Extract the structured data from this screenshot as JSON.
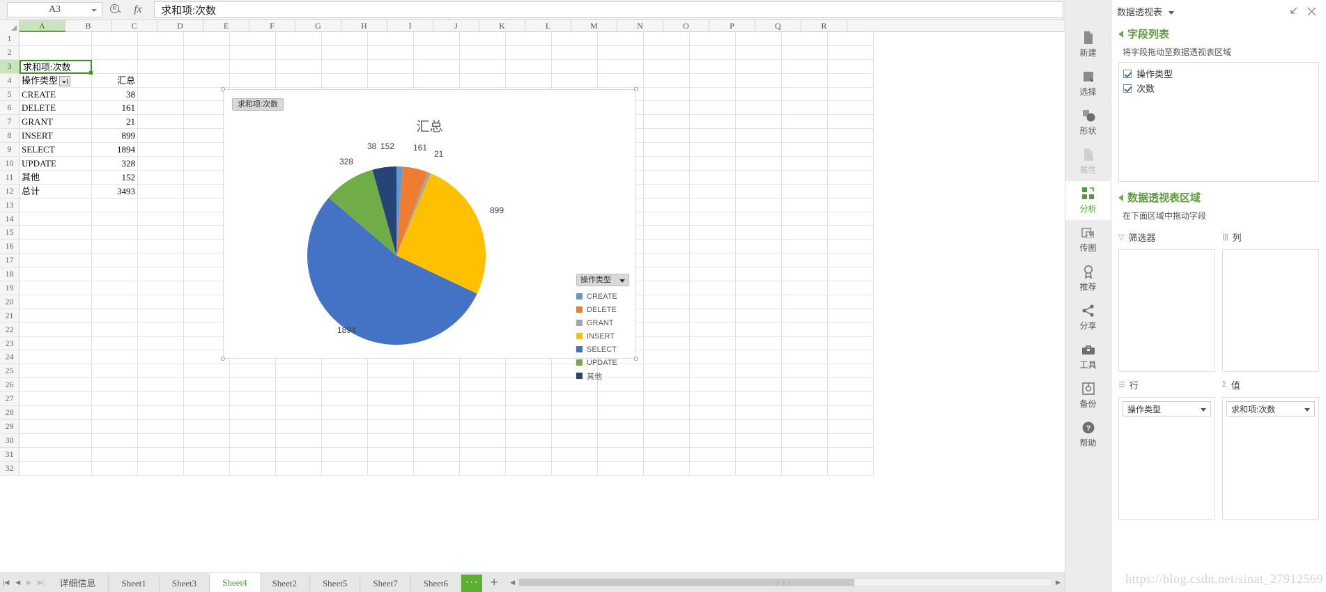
{
  "formula_bar": {
    "name_box_value": "A3",
    "search_icon": "search-icon",
    "fx_label": "fx",
    "formula_value": "求和项:次数"
  },
  "grid": {
    "columns": [
      "A",
      "B",
      "C",
      "D",
      "E",
      "F",
      "G",
      "H",
      "I",
      "J",
      "K",
      "L",
      "M",
      "N",
      "O",
      "P",
      "Q",
      "R"
    ],
    "selected_column": "A",
    "active_cell": "A3",
    "active_cell_value": "求和项:次数",
    "row_count": 32,
    "cells": {
      "A4": "操作类型",
      "B4": "汇总",
      "rows": [
        {
          "row": 5,
          "label": "CREATE",
          "value": "38"
        },
        {
          "row": 6,
          "label": "DELETE",
          "value": "161"
        },
        {
          "row": 7,
          "label": "GRANT",
          "value": "21"
        },
        {
          "row": 8,
          "label": "INSERT",
          "value": "899"
        },
        {
          "row": 9,
          "label": "SELECT",
          "value": "1894"
        },
        {
          "row": 10,
          "label": "UPDATE",
          "value": "328"
        },
        {
          "row": 11,
          "label": "其他",
          "value": "152"
        },
        {
          "row": 12,
          "label": "总计",
          "value": "3493"
        }
      ]
    }
  },
  "chart_data": {
    "type": "pie",
    "title": "汇总",
    "field_button": "求和项:次数",
    "legend_title": "操作类型",
    "legend_position": "right",
    "categories": [
      "CREATE",
      "DELETE",
      "GRANT",
      "INSERT",
      "SELECT",
      "UPDATE",
      "其他"
    ],
    "values": [
      38,
      161,
      21,
      899,
      1894,
      328,
      152
    ],
    "total": 3493,
    "colors": [
      "#5B9BD5",
      "#ED7D31",
      "#A5A5A5",
      "#FFC000",
      "#4472C4",
      "#70AD47",
      "#264478"
    ],
    "data_labels": [
      "38",
      "161",
      "21",
      "899",
      "1894",
      "328",
      "152"
    ],
    "xlabel": "",
    "ylabel": ""
  },
  "sheet_tabs": {
    "items": [
      "详细信息",
      "Sheet1",
      "Sheet3",
      "Sheet4",
      "Sheet2",
      "Sheet5",
      "Sheet7",
      "Sheet6"
    ],
    "active": "Sheet4",
    "more_label": "···",
    "add_label": "+"
  },
  "rail": {
    "items": [
      {
        "label": "新建",
        "icon": "new-document-icon",
        "state": "normal"
      },
      {
        "label": "选择",
        "icon": "select-arrow-icon",
        "state": "normal"
      },
      {
        "label": "形状",
        "icon": "shapes-icon",
        "state": "normal"
      },
      {
        "label": "属性",
        "icon": "properties-icon",
        "state": "disabled"
      },
      {
        "label": "分析",
        "icon": "analysis-icon",
        "state": "active"
      },
      {
        "label": "传图",
        "icon": "upload-image-icon",
        "state": "normal"
      },
      {
        "label": "推荐",
        "icon": "recommend-icon",
        "state": "normal"
      },
      {
        "label": "分享",
        "icon": "share-icon",
        "state": "normal"
      },
      {
        "label": "工具",
        "icon": "toolbox-icon",
        "state": "normal"
      },
      {
        "label": "备份",
        "icon": "backup-icon",
        "state": "normal"
      },
      {
        "label": "帮助",
        "icon": "help-icon",
        "state": "normal"
      }
    ]
  },
  "pane": {
    "title": "数据透视表",
    "minimize_icon": "collapse-icon",
    "close_icon": "close-icon",
    "field_list": {
      "section_title": "字段列表",
      "hint": "将字段拖动至数据透视表区域",
      "fields": [
        {
          "label": "操作类型",
          "checked": true
        },
        {
          "label": "次数",
          "checked": true
        }
      ]
    },
    "areas": {
      "section_title": "数据透视表区域",
      "hint": "在下面区域中拖动字段",
      "filter_label": "筛选器",
      "column_label": "列",
      "row_label": "行",
      "value_label": "值",
      "filter_items": [],
      "column_items": [],
      "row_items": [
        "操作类型"
      ],
      "value_items": [
        "求和项:次数"
      ]
    }
  },
  "watermark": "https://blog.csdn.net/sinat_27912569"
}
